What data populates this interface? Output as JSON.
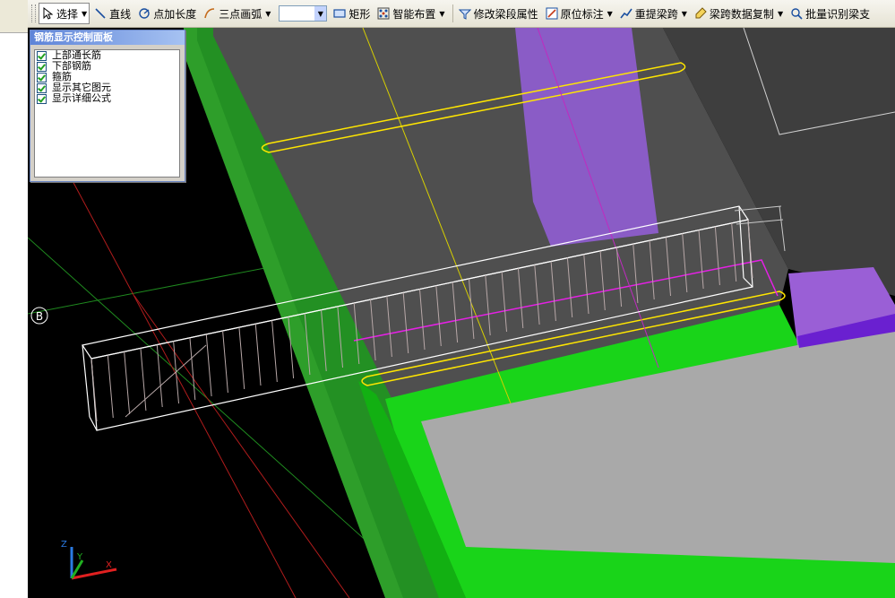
{
  "toolbar": {
    "select_label": "选择",
    "line_label": "直线",
    "point_length_label": "点加长度",
    "three_point_arc_label": "三点画弧",
    "rect_label": "矩形",
    "smart_layout_label": "智能布置",
    "modify_beam_label": "修改梁段属性",
    "original_annotation_label": "原位标注",
    "repick_span_label": "重提梁跨",
    "copy_span_data_label": "梁跨数据复制",
    "batch_identify_label": "批量识别梁支"
  },
  "panel": {
    "title": "钢筋显示控制面板",
    "items": [
      {
        "label": "上部通长筋",
        "checked": true
      },
      {
        "label": "下部钢筋",
        "checked": true
      },
      {
        "label": "箍筋",
        "checked": true
      },
      {
        "label": "显示其它图元",
        "checked": true
      },
      {
        "label": "显示详细公式",
        "checked": true
      }
    ]
  },
  "viewport": {
    "axis_marker": "B",
    "axes": {
      "x": "X",
      "y": "Y",
      "z": "Z"
    }
  },
  "colors": {
    "slab_green": "#2e9e2a",
    "beam_green": "#19d419",
    "gray_slab": "#4f4f4f",
    "light_gray": "#a9a9a9",
    "purple": "#9a5fd6",
    "rebar_yellow": "#ffe600",
    "rebar_magenta": "#e620e6"
  }
}
